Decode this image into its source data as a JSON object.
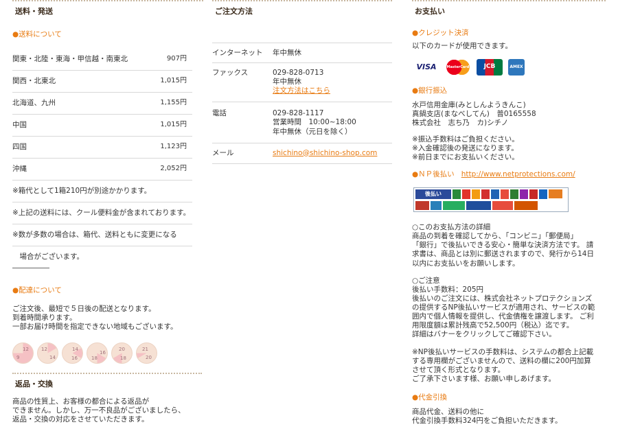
{
  "shipping": {
    "title": "送料・発送",
    "fee_heading": "●送料について",
    "rows": [
      {
        "region": "関東・北陸・東海・甲信越・南東北",
        "price": "907円"
      },
      {
        "region": "関西・北東北",
        "price": "1,015円"
      },
      {
        "region": "北海道、九州",
        "price": "1,155円"
      },
      {
        "region": "中国",
        "price": "1,015円"
      },
      {
        "region": "四国",
        "price": "1,123円"
      },
      {
        "region": "沖縄",
        "price": "2,052円"
      }
    ],
    "notes": [
      "※箱代として1箱210円が別途かかります。",
      "※上記の送料には、クール便料金が含まれております。",
      "※数が多数の場合は、箱代、送料ともに変更になる",
      "　場合がございます。"
    ],
    "delivery_heading": "●配達について",
    "delivery_lines": [
      "ご注文後、最短で５日後の配送となります。",
      "到着時間承ります。",
      "一部お届け時間を指定できない地域もございます。"
    ],
    "time_slots": [
      {
        "a": "12",
        "b": "9"
      },
      {
        "a": "12",
        "b": "14"
      },
      {
        "a": "14",
        "b": "16"
      },
      {
        "a": "16",
        "b": "18"
      },
      {
        "a": "20",
        "b": "18"
      },
      {
        "a": "21",
        "b": "20"
      }
    ]
  },
  "returns": {
    "title": "返品・交換",
    "lines": [
      "商品の性質上、お客様の都合による返品が",
      "できません。しかし、万一不良品がございましたら、",
      "返品・交換の対応をさせていただきます。"
    ]
  },
  "order": {
    "title": "ご注文方法",
    "rows": [
      {
        "key": "インターネット",
        "lines": [
          "年中無休"
        ],
        "link": ""
      },
      {
        "key": "ファックス",
        "lines": [
          "029-828-0713",
          "年中無休"
        ],
        "link": "注文方法はこちら"
      },
      {
        "key": "電話",
        "lines": [
          "029-828-1117",
          "営業時間　10:00~18:00",
          "年中無休（元日を除く）"
        ],
        "link": ""
      },
      {
        "key": "メール",
        "lines": [],
        "link": "shichino@shichino-shop.com"
      }
    ]
  },
  "payment": {
    "title": "お支払い",
    "credit_heading": "●クレジット決済",
    "credit_text": "以下のカードが使用できます。",
    "cards": [
      "VISA",
      "MasterCard",
      "JCB",
      "AMEX"
    ],
    "bank_heading": "●銀行振込",
    "bank_lines": [
      "水戸信用金庫(みとしんようきんこ)",
      "真鍋支店(まなべしてん)　普0165558",
      "株式会社　志ち乃　カ)シチノ"
    ],
    "bank_notes": [
      "※振込手数料はご負担ください。",
      "※入金確認後の発送になります。",
      "※前日までにお支払いください。"
    ],
    "np_heading": "●ＮＰ後払い",
    "np_link": "http://www.netprotections.com/",
    "np_banner_label": "後払い",
    "np_details_heading": "○このお支払方法の詳細",
    "np_details": [
      "商品の到着を確認してから、「コンビニ」「郵便局」",
      "「銀行」で後払いできる安心・簡単な決済方法です。 請",
      "求書は、商品とは別に郵送されますので、発行から14日",
      "以内にお支払いをお願いします。"
    ],
    "np_caution_heading": "○ご注意",
    "np_caution": [
      "後払い手数料：205円",
      "後払いのご注文には、株式会社ネットプロテクションズ",
      "の提供するNP後払いサービスが適用され、サービスの範",
      "囲内で個人情報を提供し、代金債権を譲渡します。 ご利",
      "用限度額は累計残高で52,500円（税込）迄です。",
      "詳細はバナーをクリックしてご確認下さい。"
    ],
    "np_fee_note": [
      "※NP後払いサービスの手数料は、システムの都合上記載",
      "する専用欄がございませんので、送料の欄に200円加算",
      "させて頂く形式となります。",
      "ご了承下さいます様、お願い申しあげます。"
    ],
    "cod_heading": "●代金引換",
    "cod_lines": [
      "商品代金、送料の他に",
      "代金引換手数料324円をご負担いただきます。"
    ]
  }
}
